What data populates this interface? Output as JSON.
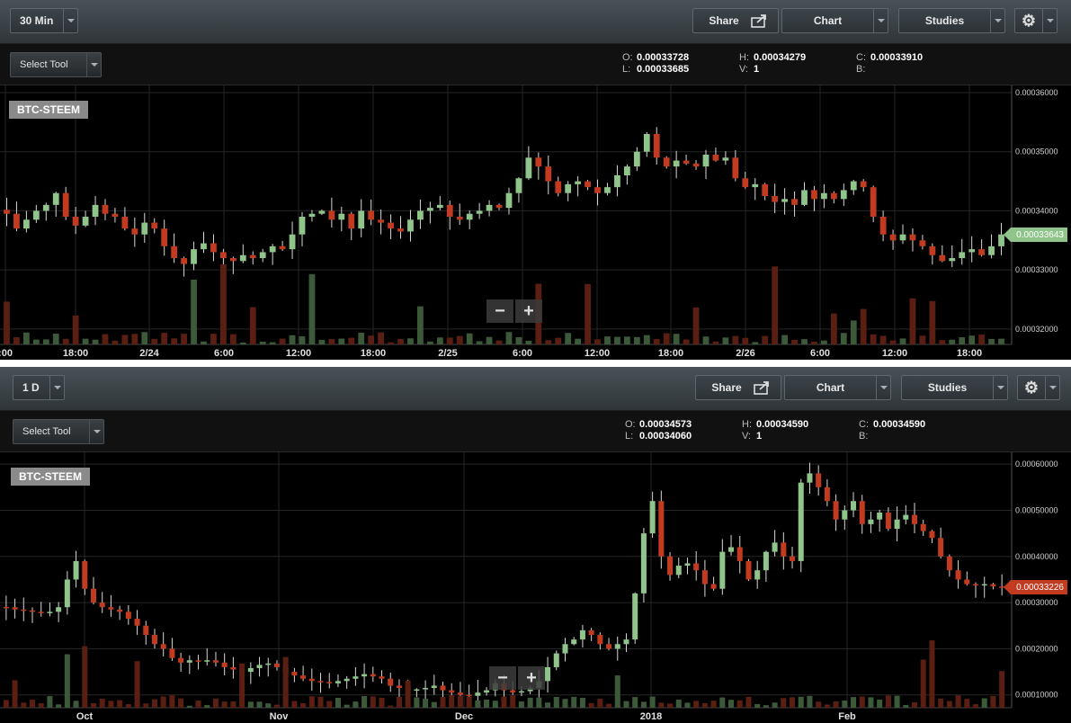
{
  "colors": {
    "up": "#8fc48a",
    "down": "#c23a1f",
    "vol_up": "#3c5a39",
    "vol_down": "#5a1f12",
    "grid": "#262626"
  },
  "top": {
    "interval": "30 Min",
    "share_label": "Share",
    "chart_label": "Chart",
    "studies_label": "Studies",
    "select_tool": "Select Tool",
    "ohlc": {
      "o": "0.00033728",
      "h": "0.00034279",
      "c": "0.00033910",
      "l": "0.00033685",
      "v": "1",
      "b": ""
    },
    "symbol": "BTC-STEEM",
    "last_price": "0.00033643",
    "chart_data": {
      "type": "candlestick",
      "x_ticks": [
        ":00",
        "18:00",
        "2/24",
        "6:00",
        "12:00",
        "18:00",
        "2/25",
        "6:00",
        "12:00",
        "18:00",
        "2/26",
        "6:00",
        "12:00",
        "18:00"
      ],
      "y_ticks": [
        "0.00036000",
        "0.00035000",
        "0.00034000",
        "0.00033000",
        "0.00032000"
      ],
      "ylim": [
        0.000318,
        0.00036
      ],
      "closes": [
        0.0003395,
        0.000337,
        0.0003385,
        0.00034,
        0.000341,
        0.000343,
        0.000339,
        0.0003375,
        0.000339,
        0.000341,
        0.0003395,
        0.000339,
        0.000337,
        0.000336,
        0.000338,
        0.000337,
        0.000334,
        0.000332,
        0.000331,
        0.0003335,
        0.0003345,
        0.000333,
        0.000332,
        0.0003315,
        0.0003325,
        0.000332,
        0.000333,
        0.000334,
        0.0003335,
        0.000336,
        0.000339,
        0.0003395,
        0.00034,
        0.0003385,
        0.0003395,
        0.000337,
        0.00034,
        0.0003385,
        0.000338,
        0.000337,
        0.0003365,
        0.0003385,
        0.00034,
        0.0003405,
        0.000341,
        0.000339,
        0.0003385,
        0.0003395,
        0.00034,
        0.000341,
        0.0003405,
        0.000343,
        0.0003455,
        0.000349,
        0.0003475,
        0.000345,
        0.000343,
        0.0003445,
        0.000345,
        0.000344,
        0.000343,
        0.000344,
        0.000346,
        0.0003475,
        0.00035,
        0.000353,
        0.000349,
        0.0003475,
        0.0003485,
        0.000348,
        0.0003475,
        0.0003495,
        0.0003485,
        0.000349,
        0.0003455,
        0.000344,
        0.0003445,
        0.0003425,
        0.0003415,
        0.000342,
        0.000341,
        0.0003435,
        0.000342,
        0.000343,
        0.000342,
        0.0003435,
        0.000345,
        0.000344,
        0.000339,
        0.000336,
        0.000335,
        0.000336,
        0.000335,
        0.000334,
        0.0003325,
        0.0003315,
        0.000332,
        0.000333,
        0.0003335,
        0.0003325,
        0.000334,
        0.000336
      ]
    }
  },
  "bottom": {
    "interval": "1 D",
    "share_label": "Share",
    "chart_label": "Chart",
    "studies_label": "Studies",
    "select_tool": "Select Tool",
    "ohlc": {
      "o": "0.00034573",
      "h": "0.00034590",
      "c": "0.00034590",
      "l": "0.00034060",
      "v": "1",
      "b": ""
    },
    "symbol": "BTC-STEEM",
    "last_price": "0.00033226",
    "chart_data": {
      "type": "candlestick",
      "x_ticks": [
        "Oct",
        "Nov",
        "Dec",
        "2018",
        "Feb"
      ],
      "y_ticks": [
        "0.00060000",
        "0.00050000",
        "0.00040000",
        "0.00030000",
        "0.00020000",
        "0.00010000"
      ],
      "ylim": [
        8e-05,
        0.00061
      ],
      "closes": [
        0.00029,
        0.000285,
        0.000283,
        0.00028,
        0.000279,
        0.00028,
        0.00029,
        0.00035,
        0.00039,
        0.00033,
        0.0003,
        0.00029,
        0.000285,
        0.00028,
        0.000265,
        0.00025,
        0.00023,
        0.00021,
        0.0002,
        0.00018,
        0.00017,
        0.000175,
        0.000172,
        0.000175,
        0.00017,
        0.00016,
        0.000155,
        0.00015,
        0.000158,
        0.000165,
        0.000168,
        0.00016,
        0.00015,
        0.000142,
        0.000135,
        0.00013,
        0.000128,
        0.000125,
        0.00013,
        0.000135,
        0.00014,
        0.000145,
        0.00014,
        0.000135,
        0.00012,
        0.000115,
        0.00011,
        0.000112,
        0.000115,
        0.00012,
        0.00011,
        0.000105,
        0.0001,
        9.8e-05,
        0.000105,
        0.00011,
        0.000125,
        0.00011,
        0.000105,
        0.000108,
        0.000115,
        0.00013,
        0.00016,
        0.00019,
        0.00021,
        0.00022,
        0.00024,
        0.00023,
        0.00021,
        0.0002,
        0.00021,
        0.00022,
        0.00032,
        0.00045,
        0.00052,
        0.0004,
        0.00036,
        0.00038,
        0.000385,
        0.00037,
        0.00034,
        0.00033,
        0.00041,
        0.00042,
        0.00039,
        0.00035,
        0.00037,
        0.00041,
        0.00043,
        0.0004,
        0.00039,
        0.00056,
        0.00058,
        0.00055,
        0.00052,
        0.00048,
        0.0005,
        0.00052,
        0.00047,
        0.00048,
        0.000495,
        0.00046,
        0.00048,
        0.00049,
        0.00047,
        0.000455,
        0.00044,
        0.0004,
        0.00037,
        0.00035,
        0.00034,
        0.000338,
        0.00034,
        0.000335,
        0.00033226
      ]
    }
  }
}
